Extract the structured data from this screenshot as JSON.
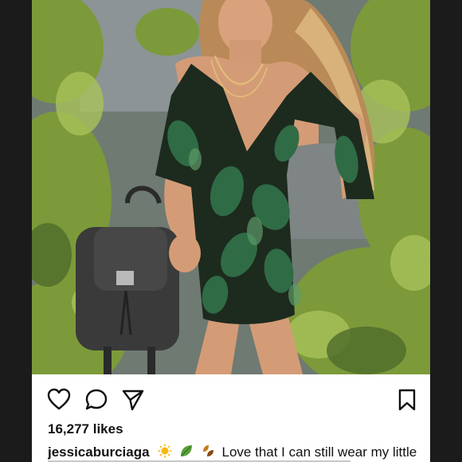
{
  "post": {
    "likes_text": "16,277 likes",
    "username": "jessicaburciaga",
    "caption_text": "Love that I can still wear my little",
    "caption_emojis": [
      "sun-emoji",
      "leaf-emoji",
      "fallen-leaves-emoji"
    ],
    "colors": {
      "frame_bg": "#1b1b1b",
      "card_bg": "#ffffff",
      "text": "#111111"
    }
  },
  "actions": {
    "like_icon": "heart-icon",
    "comment_icon": "speech-bubble-icon",
    "share_icon": "paper-plane-icon",
    "save_icon": "bookmark-icon"
  }
}
